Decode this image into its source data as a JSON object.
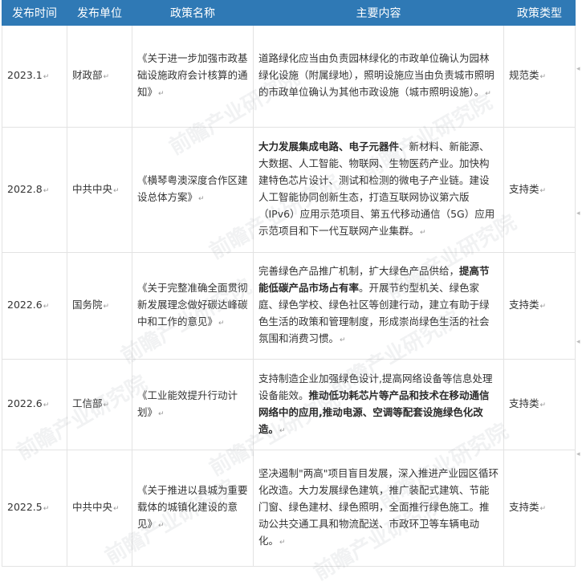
{
  "table": {
    "headers": [
      "发布时间",
      "发布单位",
      "政策名称",
      "主要内容",
      "政策类型"
    ],
    "rows": [
      {
        "date": "2023.1",
        "org": "财政部",
        "name": "《关于进一步加强市政基础设施政府会计核算的通知》",
        "content": [
          {
            "t": "道路绿化应当由负责园林绿化的市政单位确认为园林绿化设施（附属绿地），照明设施应当由负责城市照明的市政单位确认为其他市政设施（城市照明设施）。",
            "b": false
          }
        ],
        "type": "规范类"
      },
      {
        "date": "2022.8",
        "org": "中共中央",
        "name": "《横琴粤澳深度合作区建设总体方案》",
        "content": [
          {
            "t": "大力发展集成电路、电子元器件",
            "b": true
          },
          {
            "t": "、新材料、新能源、大数据、人工智能、物联网、生物医药产业。加快构建特色芯片设计、测试和检测的微电子产业链。建设人工智能协同创新生态，打造互联网协议第六版（IPv6）应用示范项目、第五代移动通信（5G）应用示范项目和下一代互联网产业集群。",
            "b": false
          }
        ],
        "type": "支持类"
      },
      {
        "date": "2022.6",
        "org": "国务院",
        "name": "《关于完整准确全面贯彻新发展理念做好碳达峰碳中和工作的意见》",
        "content": [
          {
            "t": "完善绿色产品推广机制，扩大绿色产品供给，",
            "b": false
          },
          {
            "t": "提高节能低碳产品市场占有率",
            "b": true
          },
          {
            "t": "。开展节约型机关、绿色家庭、绿色学校、绿色社区等创建行动，建立有助于绿色生活的政策和管理制度，形成崇尚绿色生活的社会氛围和消费习惯。",
            "b": false
          }
        ],
        "type": "支持类"
      },
      {
        "date": "2022.6",
        "org": "工信部",
        "name": "《工业能效提升行动计划》",
        "content": [
          {
            "t": "支持制造企业加强绿色设计,提高网络设备等信息处理设备能效。",
            "b": false
          },
          {
            "t": "推动低功耗芯片等产品和技术在移动通信网络中的应用,推动电源、空调等配套设施绿色化改造。",
            "b": true
          }
        ],
        "type": "支持类"
      },
      {
        "date": "2022.5",
        "org": "中共中央",
        "name": "《关于推进以县城为重要载体的城镇化建设的意见》",
        "content": [
          {
            "t": "坚决遏制\"两高\"项目盲目发展，深入推进产业园区循环化改造。大力发展绿色建筑，推广装配式建筑、节能门窗、绿色建材、绿色照明，全面推行绿色施工。推动公共交通工具和物流配送、市政环卫等车辆电动化。",
            "b": false
          }
        ],
        "type": "支持类"
      }
    ]
  },
  "watermark": {
    "text": "前瞻产业研究院"
  }
}
